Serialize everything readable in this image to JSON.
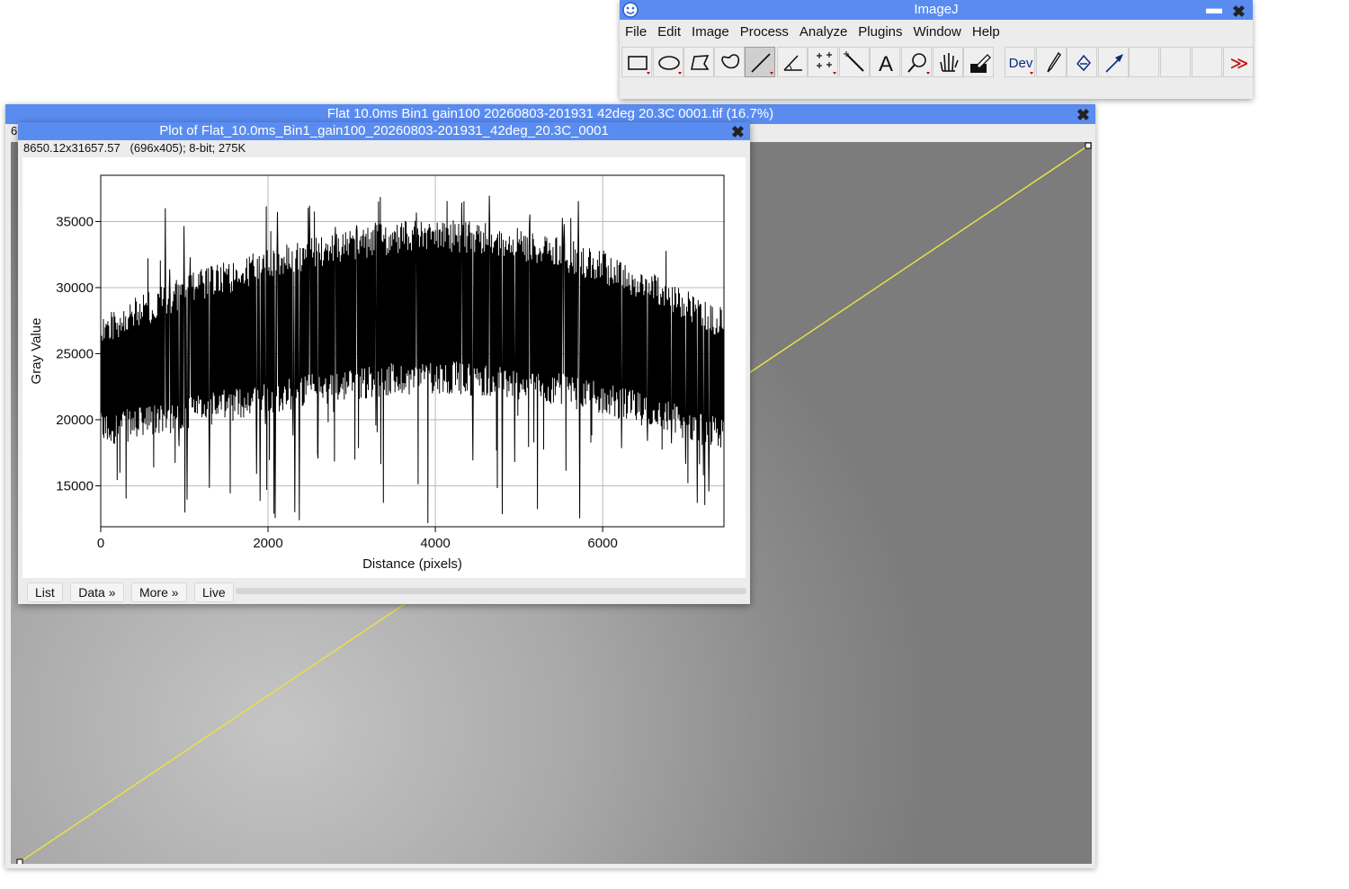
{
  "imagej": {
    "title": "ImageJ",
    "menus": [
      "File",
      "Edit",
      "Image",
      "Process",
      "Analyze",
      "Plugins",
      "Window",
      "Help"
    ],
    "tools": [
      {
        "name": "rectangle-tool-icon"
      },
      {
        "name": "oval-tool-icon"
      },
      {
        "name": "polygon-tool-icon"
      },
      {
        "name": "freehand-tool-icon"
      },
      {
        "name": "line-tool-icon",
        "selected": true
      },
      {
        "name": "angle-tool-icon"
      },
      {
        "name": "multipoint-tool-icon"
      },
      {
        "name": "wand-tool-icon"
      },
      {
        "name": "text-tool-icon",
        "label": "A"
      },
      {
        "name": "magnifier-tool-icon"
      },
      {
        "name": "hand-tool-icon"
      },
      {
        "name": "color-picker-tool-icon"
      },
      {
        "name": "developer-menu-icon",
        "label": "Dev"
      },
      {
        "name": "brush-tool-icon"
      },
      {
        "name": "flood-fill-tool-icon"
      },
      {
        "name": "arrow-tool-icon"
      },
      {
        "name": "empty-slot"
      },
      {
        "name": "empty-slot"
      },
      {
        "name": "empty-slot"
      },
      {
        "name": "more-tools-icon",
        "label": "≫"
      }
    ]
  },
  "image_window": {
    "title": "Flat  10.0ms  Bin1  gain100  20260803-201931  42deg  20.3C  0001.tif (16.7%)",
    "info_stub": "6",
    "roi_line_color": "#e8e04a"
  },
  "plot_window": {
    "title": "Plot of Flat_10.0ms_Bin1_gain100_20260803-201931_42deg_20.3C_0001",
    "info": "8650.12x31657.57   (696x405); 8-bit; 275K",
    "buttons": {
      "list": "List",
      "data": "Data »",
      "more": "More »",
      "live": "Live"
    }
  },
  "chart_data": {
    "type": "line",
    "title": "",
    "xlabel": "Distance (pixels)",
    "ylabel": "Gray Value",
    "xlim": [
      0,
      7450
    ],
    "ylim": [
      11900,
      38500
    ],
    "xticks": [
      0,
      2000,
      4000,
      6000
    ],
    "yticks": [
      15000,
      20000,
      25000,
      30000,
      35000
    ],
    "grid": true,
    "series": [
      {
        "color": "#000000",
        "x": [
          0,
          500,
          1000,
          1500,
          2000,
          2500,
          3000,
          3500,
          4000,
          4500,
          5000,
          5500,
          6000,
          6500,
          7000,
          7450
        ],
        "upper": [
          28000,
          29500,
          31000,
          32000,
          33000,
          33800,
          34500,
          35000,
          35200,
          35000,
          34600,
          33800,
          32800,
          31500,
          30000,
          28500
        ],
        "lower": [
          18000,
          18500,
          19200,
          19800,
          20400,
          21000,
          21500,
          21800,
          22000,
          21800,
          21500,
          21000,
          20400,
          19500,
          18500,
          17500
        ],
        "spike_high": 37500,
        "spike_low": 12000
      }
    ]
  }
}
